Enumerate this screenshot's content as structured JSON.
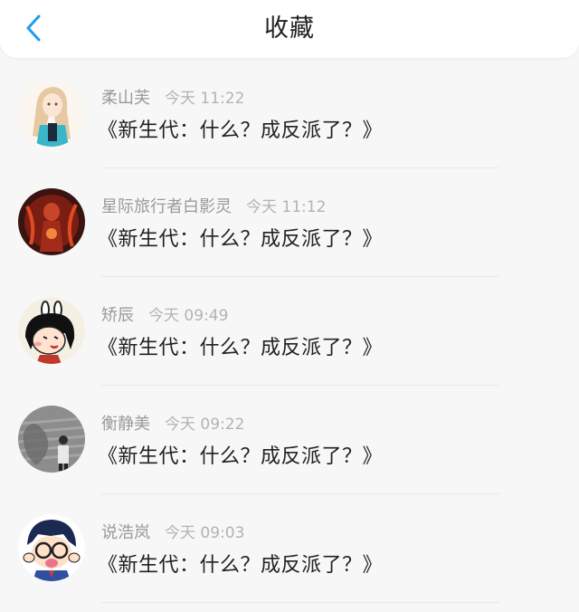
{
  "header": {
    "title": "收藏",
    "back_icon": "chevron-left-icon",
    "accent_color": "#1e9bf0"
  },
  "items": [
    {
      "name": "柔山芙",
      "time": "今天 11:22",
      "message": "《新生代：什么？成反派了？》",
      "avatar": "anime-girl-avatar"
    },
    {
      "name": "星际旅行者白影灵",
      "time": "今天 11:12",
      "message": "《新生代：什么？成反派了？》",
      "avatar": "fire-figure-avatar"
    },
    {
      "name": "矫辰",
      "time": "今天 09:49",
      "message": "《新生代：什么？成反派了？》",
      "avatar": "cartoon-girl-avatar"
    },
    {
      "name": "衡静美",
      "time": "今天 09:22",
      "message": "《新生代：什么？成反派了？》",
      "avatar": "grey-photo-avatar"
    },
    {
      "name": "说浩岚",
      "time": "今天 09:03",
      "message": "《新生代：什么？成反派了？》",
      "avatar": "cartoon-boy-avatar"
    }
  ]
}
